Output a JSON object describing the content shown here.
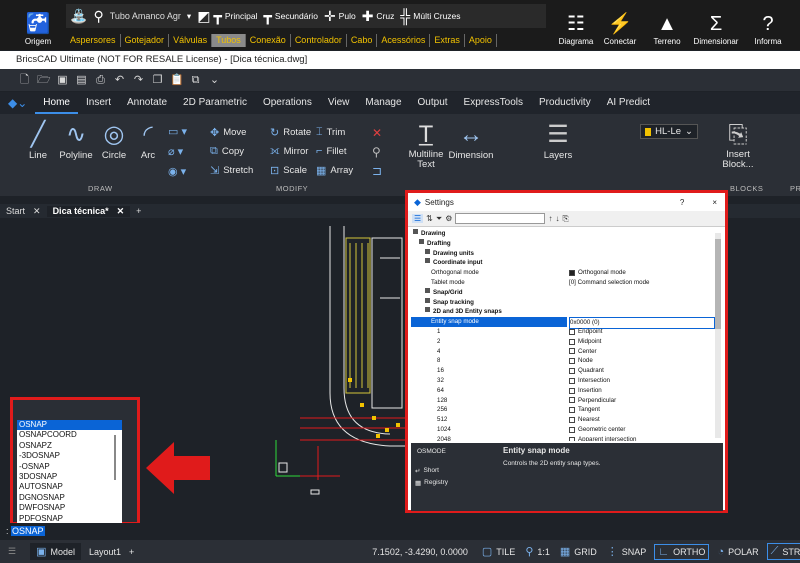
{
  "plugin_toolbar": {
    "origin_label": "Origem",
    "pipe_combo": "Tubo Amanco Agr",
    "tools": [
      "Principal",
      "Secundário",
      "Pulo",
      "Cruz",
      "Múlti Cruzes"
    ],
    "categories": [
      "Aspersores",
      "Gotejador",
      "Válvulas",
      "Tubos",
      "Conexão",
      "Controlador",
      "Cabo",
      "Acessórios",
      "Extras",
      "Apoio"
    ],
    "selected_category": "Tubos",
    "right_buttons": [
      "Diagrama",
      "Conectar",
      "Terreno",
      "Dimensionar",
      "Informa"
    ]
  },
  "window_title": "BricsCAD Ultimate (NOT FOR RESALE License) - [Dica técnica.dwg]",
  "ribbon": {
    "tabs": [
      "Home",
      "Insert",
      "Annotate",
      "2D Parametric",
      "Operations",
      "View",
      "Manage",
      "Output",
      "ExpressTools",
      "Productivity",
      "AI Predict"
    ],
    "selected_tab": "Home",
    "draw": {
      "label": "DRAW",
      "buttons": [
        "Line",
        "Polyline",
        "Circle",
        "Arc"
      ]
    },
    "modify": {
      "label": "MODIFY",
      "buttons": [
        "Move",
        "Rotate",
        "Trim",
        "Copy",
        "Mirror",
        "Fillet",
        "Stretch",
        "Scale",
        "Array"
      ]
    },
    "annotations": {
      "label": "ANNOTATIONS",
      "buttons": [
        "Multiline Text",
        "Dimension"
      ]
    },
    "layers": {
      "label": "LAYERS",
      "button": "Layers",
      "current_layer": "HL-Le"
    },
    "blocks": {
      "label": "BLOCKS",
      "button": "Insert Block..."
    },
    "extra_label": "PR"
  },
  "doc_tabs": [
    "Start",
    "Dica técnica*"
  ],
  "settings": {
    "title": "Settings",
    "help": "?",
    "close": "×",
    "tree": [
      {
        "name": "Drawing",
        "level": 0,
        "bold": true
      },
      {
        "name": "Drafting",
        "level": 1,
        "bold": true
      },
      {
        "name": "Drawing units",
        "level": 2,
        "bold": true
      },
      {
        "name": "Coordinate input",
        "level": 2,
        "bold": true
      },
      {
        "name": "Orthogonal mode",
        "level": 3,
        "value": "Orthogonal mode",
        "checkbox": true,
        "checked": true
      },
      {
        "name": "Tablet mode",
        "level": 3,
        "value": "[0] Command selection mode"
      },
      {
        "name": "Snap/Grid",
        "level": 2,
        "bold": true
      },
      {
        "name": "Snap tracking",
        "level": 2,
        "bold": true
      },
      {
        "name": "2D and 3D Entity snaps",
        "level": 2,
        "bold": true
      },
      {
        "name": "Entity snap mode",
        "level": 3,
        "value": "0x0000 (0)",
        "selected": true
      },
      {
        "name": "1",
        "level": 4,
        "value": "Endpoint",
        "checkbox": true
      },
      {
        "name": "2",
        "level": 4,
        "value": "Midpoint",
        "checkbox": true
      },
      {
        "name": "4",
        "level": 4,
        "value": "Center",
        "checkbox": true
      },
      {
        "name": "8",
        "level": 4,
        "value": "Node",
        "checkbox": true
      },
      {
        "name": "16",
        "level": 4,
        "value": "Quadrant",
        "checkbox": true
      },
      {
        "name": "32",
        "level": 4,
        "value": "Intersection",
        "checkbox": true
      },
      {
        "name": "64",
        "level": 4,
        "value": "Insertion",
        "checkbox": true
      },
      {
        "name": "128",
        "level": 4,
        "value": "Perpendicular",
        "checkbox": true
      },
      {
        "name": "256",
        "level": 4,
        "value": "Tangent",
        "checkbox": true
      },
      {
        "name": "512",
        "level": 4,
        "value": "Nearest",
        "checkbox": true
      },
      {
        "name": "1024",
        "level": 4,
        "value": "Geometric center",
        "checkbox": true
      },
      {
        "name": "2048",
        "level": 4,
        "value": "Apparent intersection",
        "checkbox": true
      }
    ],
    "info": {
      "var": "OSMODE",
      "heading": "Entity snap mode",
      "description": "Controls the 2D entity snap types.",
      "short": "Short",
      "registry": "Registry"
    }
  },
  "command_list": [
    "OSNAP",
    "OSNAPCOORD",
    "OSNAPZ",
    "-3DOSNAP",
    "-OSNAP",
    "3DOSNAP",
    "AUTOSNAP",
    "DGNOSNAP",
    "DWFOSNAP",
    "PDFOSNAP"
  ],
  "command_line": {
    "prompt": ":",
    "input": "OSNAP"
  },
  "status_bar": {
    "tabs": [
      "Model",
      "Layout1"
    ],
    "coords": "7.1502, -3.4290, 0.0000",
    "toggles": [
      "TILE",
      "1:1",
      "GRID",
      "SNAP",
      "ORTHO",
      "POLAR",
      "STRA"
    ]
  },
  "colors": {
    "accent": "#3c8ee8",
    "highlight_red": "#e01b1b",
    "category_yellow": "#f2c200",
    "selection_blue": "#0a64d6"
  }
}
